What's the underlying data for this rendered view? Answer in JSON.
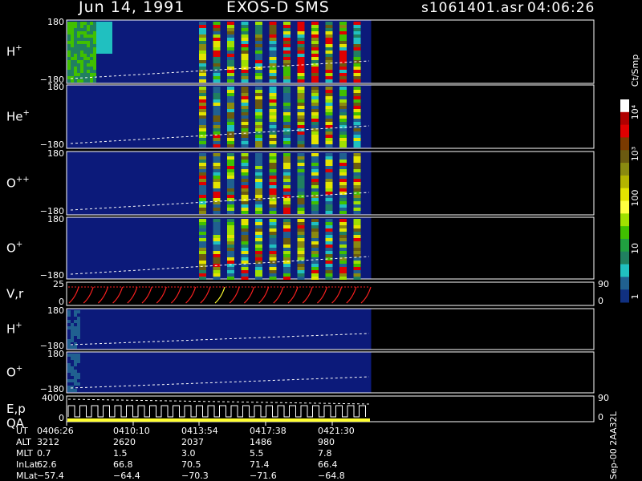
{
  "header": {
    "date": "Jun 14, 1991",
    "instrument": "EXOS-D SMS",
    "filename": "s1061401.asr",
    "time": "04:06:26"
  },
  "panels": [
    {
      "id": "h1",
      "label": "H",
      "charge": "+",
      "ymax": "180",
      "ymin": "−180"
    },
    {
      "id": "he",
      "label": "He",
      "charge": "+",
      "ymax": "180",
      "ymin": "−180"
    },
    {
      "id": "opp",
      "label": "O",
      "charge": "++",
      "ymax": "180",
      "ymin": "−180"
    },
    {
      "id": "o1",
      "label": "O",
      "charge": "+",
      "ymax": "180",
      "ymin": "−180"
    },
    {
      "id": "vr",
      "label": "V,r",
      "charge": "",
      "ymax": "25",
      "ymin": "0",
      "right_max": "90",
      "right_min": "0"
    },
    {
      "id": "h2",
      "label": "H",
      "charge": "+",
      "ymax": "180",
      "ymin": "−180"
    },
    {
      "id": "o2",
      "label": "O",
      "charge": "+",
      "ymax": "180",
      "ymin": "−180"
    },
    {
      "id": "ep",
      "label": "E,p",
      "label2": "QA",
      "charge": "",
      "ymax": "4000",
      "ymin": "0",
      "right_max": "90",
      "right_min": "0"
    }
  ],
  "colorbar": {
    "unit": "Ct/Smp",
    "labels": [
      "10⁴",
      "10³",
      "100",
      "10",
      "1"
    ],
    "colors": [
      "#ffffff",
      "#b00000",
      "#e00000",
      "#7a3a00",
      "#6b5a10",
      "#8a8a10",
      "#b4b400",
      "#e4e400",
      "#ffff40",
      "#a0e000",
      "#40c000",
      "#20a040",
      "#208060",
      "#20c0c0",
      "#206090",
      "#103080"
    ]
  },
  "ephemeris": {
    "rows": [
      {
        "name": "UT",
        "values": [
          "0406:26",
          "0410:10",
          "0413:54",
          "0417:38",
          "0421:30"
        ]
      },
      {
        "name": "ALT",
        "values": [
          "3212",
          "2620",
          "2037",
          "1486",
          "980"
        ]
      },
      {
        "name": "MLT",
        "values": [
          "0.7",
          "1.5",
          "3.0",
          "5.5",
          "7.8"
        ]
      },
      {
        "name": "InLat",
        "values": [
          "62.6",
          "66.8",
          "70.5",
          "71.4",
          "66.4"
        ]
      },
      {
        "name": "MLat",
        "values": [
          "−57.4",
          "−64.4",
          "−70.3",
          "−71.6",
          "−64.8"
        ]
      }
    ]
  },
  "footer_note": "Sep-00 2AA32L",
  "colors": {
    "background": "#000000",
    "panel_fill": "#0c1a7a",
    "dashed_line": "#ffffff",
    "vr_red": "#ff2020",
    "qa_yellow": "#ffff30"
  }
}
